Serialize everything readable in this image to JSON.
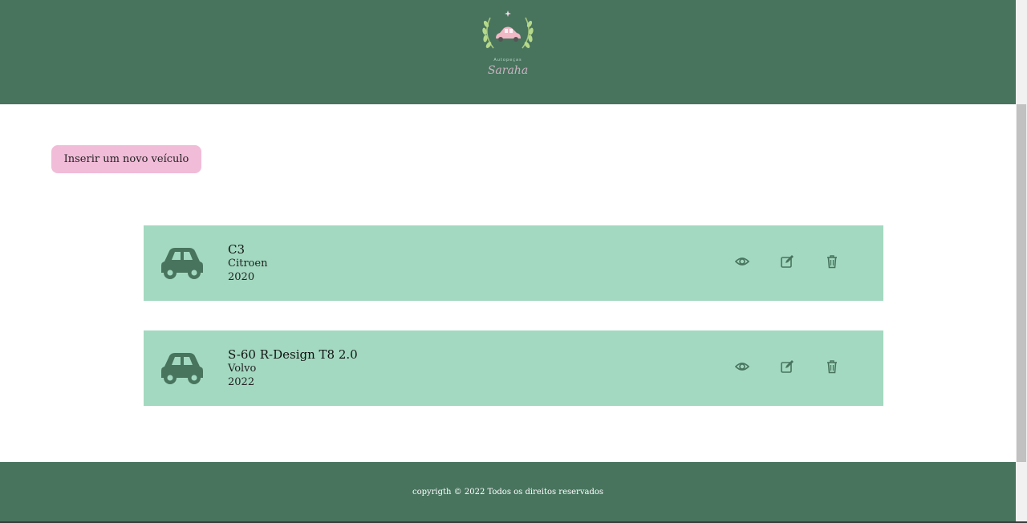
{
  "brand": {
    "tagline": "Autopeças",
    "name": "Saraha"
  },
  "actions": {
    "insert_label": "Inserir um novo veículo"
  },
  "vehicles": [
    {
      "model": "C3",
      "brand": "Citroen",
      "year": "2020"
    },
    {
      "model": "S-60 R-Design T8 2.0",
      "brand": "Volvo",
      "year": "2022"
    }
  ],
  "icons": {
    "vehicle": "car-icon",
    "view": "eye-icon",
    "edit": "edit-icon",
    "delete": "trash-icon"
  },
  "footer": {
    "copyright": "copyrigth © 2022 Todos os direitos reservados"
  },
  "colors": {
    "primary": "#48745e",
    "card": "#a3d9c0",
    "button": "#f1bcd8"
  }
}
